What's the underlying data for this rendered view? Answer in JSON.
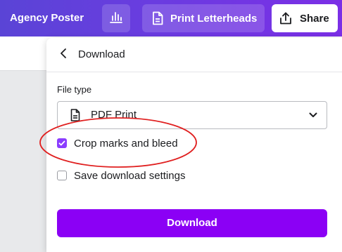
{
  "header": {
    "doc_title": "Agency Poster",
    "chart_icon": "bar-chart-icon",
    "print_button": {
      "label": "Print Letterheads",
      "icon": "document-icon"
    },
    "share_button": {
      "label": "Share",
      "icon": "share-upload-icon"
    },
    "colors": {
      "gradient_start": "#5a44d6",
      "gradient_end": "#7b2fe6"
    }
  },
  "panel": {
    "title": "Download",
    "back_icon": "chevron-left-icon",
    "file_type": {
      "label": "File type",
      "value": "PDF Print",
      "icon": "document-icon",
      "dropdown_icon": "chevron-down-icon"
    },
    "options": [
      {
        "label": "Crop marks and bleed",
        "checked": true
      },
      {
        "label": "Save download settings",
        "checked": false
      }
    ],
    "download_button": {
      "label": "Download"
    },
    "colors": {
      "accent": "#8b3dff",
      "button": "#8b00f5",
      "annotation": "#e02020"
    }
  }
}
